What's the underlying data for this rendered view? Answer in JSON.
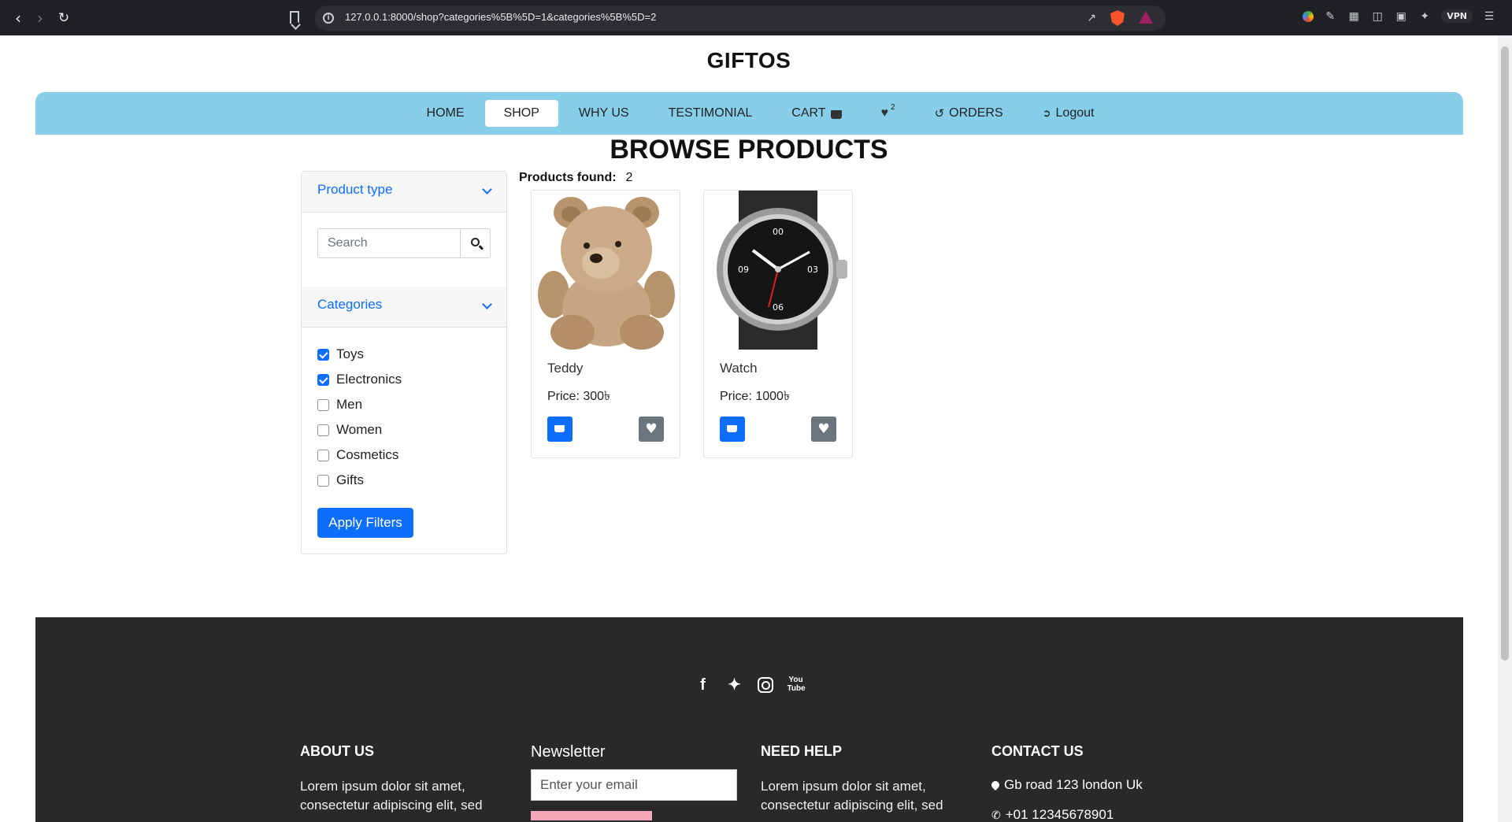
{
  "browser": {
    "url": "127.0.0.1:8000/shop?categories%5B%5D=1&categories%5B%5D=2",
    "vpn_label": "VPN"
  },
  "site": {
    "brand": "GIFTOS"
  },
  "nav": {
    "items": [
      {
        "label": "HOME"
      },
      {
        "label": "SHOP",
        "active": true
      },
      {
        "label": "WHY US"
      },
      {
        "label": "TESTIMONIAL"
      },
      {
        "label": "CART"
      },
      {
        "label": "",
        "badge": "2"
      },
      {
        "label": "ORDERS"
      },
      {
        "label": "Logout"
      }
    ]
  },
  "main": {
    "title": "BROWSE PRODUCTS",
    "found_label": "Products found:",
    "found_count": "2"
  },
  "sidebar": {
    "product_type_label": "Product type",
    "search_placeholder": "Search",
    "categories_label": "Categories",
    "categories": [
      {
        "label": "Toys",
        "checked": true
      },
      {
        "label": "Electronics",
        "checked": true
      },
      {
        "label": "Men",
        "checked": false
      },
      {
        "label": "Women",
        "checked": false
      },
      {
        "label": "Cosmetics",
        "checked": false
      },
      {
        "label": "Gifts",
        "checked": false
      }
    ],
    "apply_label": "Apply Filters"
  },
  "products": [
    {
      "name": "Teddy",
      "price": "Price: 300৳"
    },
    {
      "name": "Watch",
      "price": "Price: 1000৳"
    }
  ],
  "footer": {
    "about_title": "ABOUT US",
    "about_text": "Lorem ipsum dolor sit amet, consectetur adipiscing elit, sed",
    "newsletter_title": "Newsletter",
    "email_placeholder": "Enter your email",
    "help_title": "NEED HELP",
    "help_text": "Lorem ipsum dolor sit amet, consectetur adipiscing elit, sed",
    "contact_title": "CONTACT US",
    "address": "Gb road 123 london Uk",
    "phone": "+01 12345678901"
  },
  "colors": {
    "nav_bg": "#87ceea",
    "primary": "#0d6efd",
    "footer_bg": "#292929"
  }
}
